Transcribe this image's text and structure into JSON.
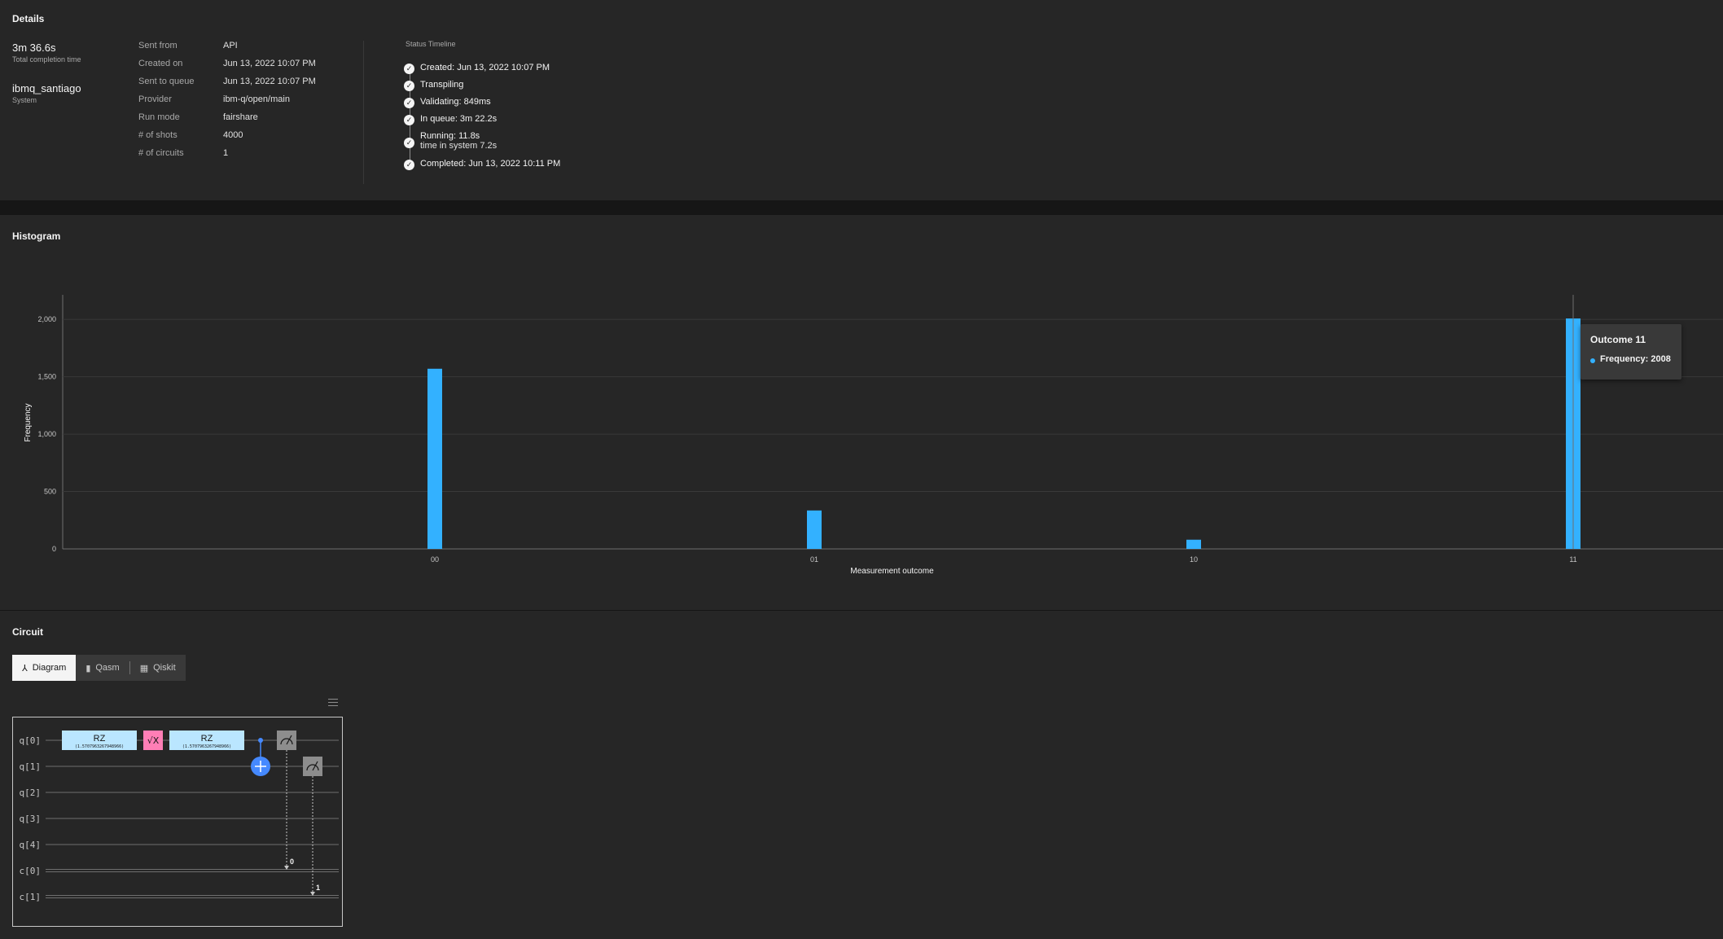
{
  "details": {
    "title": "Details",
    "completion_time": "3m 36.6s",
    "completion_label": "Total completion time",
    "system_name": "ibmq_santiago",
    "system_label": "System",
    "fields": [
      {
        "key": "Sent from",
        "value": "API"
      },
      {
        "key": "Created on",
        "value": "Jun 13, 2022 10:07 PM"
      },
      {
        "key": "Sent to queue",
        "value": "Jun 13, 2022 10:07 PM"
      },
      {
        "key": "Provider",
        "value": "ibm-q/open/main"
      },
      {
        "key": "Run mode",
        "value": "fairshare"
      },
      {
        "key": "# of shots",
        "value": "4000"
      },
      {
        "key": "# of circuits",
        "value": "1"
      }
    ],
    "timeline_title": "Status Timeline",
    "timeline": [
      {
        "text": "Created: Jun 13, 2022 10:07 PM",
        "sub": ""
      },
      {
        "text": "Transpiling",
        "sub": ""
      },
      {
        "text": "Validating: 849ms",
        "sub": ""
      },
      {
        "text": "In queue: 3m 22.2s",
        "sub": ""
      },
      {
        "text": "Running: 11.8s",
        "sub": "time in system 7.2s"
      },
      {
        "text": "Completed: Jun 13, 2022 10:11 PM",
        "sub": ""
      }
    ]
  },
  "histogram": {
    "title": "Histogram",
    "tooltip": {
      "title": "Outcome 11",
      "text": "Frequency: 2008"
    },
    "bar_color": "#33b1ff"
  },
  "chart_data": {
    "type": "bar",
    "categories": [
      "00",
      "01",
      "10",
      "11"
    ],
    "values": [
      1570,
      335,
      80,
      2008
    ],
    "xlabel": "Measurement outcome",
    "ylabel": "Frequency",
    "ylim": [
      0,
      2200
    ],
    "yticks": [
      "0",
      "500",
      "1,000",
      "1,500",
      "2,000"
    ],
    "ytick_values": [
      0,
      500,
      1000,
      1500,
      2000
    ],
    "grid": true
  },
  "circuit": {
    "title": "Circuit",
    "tabs": [
      {
        "label": "Diagram",
        "icon": "diagram-icon"
      },
      {
        "label": "Qasm",
        "icon": "chart-icon"
      },
      {
        "label": "Qiskit",
        "icon": "table-icon"
      }
    ],
    "wires": [
      "q[0]",
      "q[1]",
      "q[2]",
      "q[3]",
      "q[4]",
      "c[0]",
      "c[1]"
    ],
    "gates": {
      "rz_label": "RZ",
      "rz_param": "(1.5707963267948966)",
      "sx_label": "√X"
    },
    "classical_bits": [
      "0",
      "1"
    ],
    "colors": {
      "rz": "#bae6ff",
      "sx": "#ff7eb6",
      "cx": "#4589ff",
      "measure": "#8d8d8d"
    }
  }
}
